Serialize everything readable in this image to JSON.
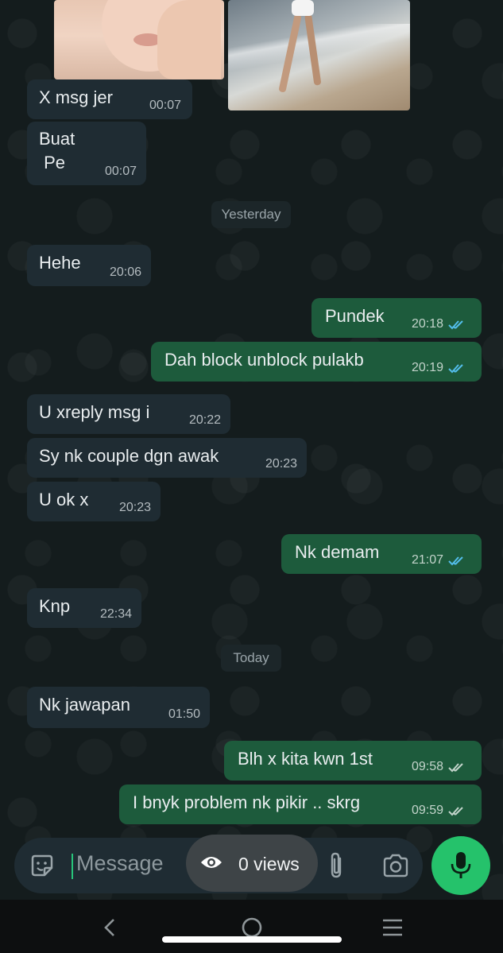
{
  "messages": [
    {
      "text": "X msg jer",
      "time": "00:07"
    },
    {
      "text": "Buat\n Pe",
      "time": "00:07"
    },
    {
      "text": "Hehe",
      "time": "20:06"
    },
    {
      "text": "Pundek",
      "time": "20:18"
    },
    {
      "text": "Dah block unblock pulakb",
      "time": "20:19"
    },
    {
      "text": "U xreply msg i",
      "time": "20:22"
    },
    {
      "text": "Sy nk couple dgn awak",
      "time": "20:23"
    },
    {
      "text": "U ok x",
      "time": "20:23"
    },
    {
      "text": "Nk demam",
      "time": "21:07"
    },
    {
      "text": "Knp",
      "time": "22:34"
    },
    {
      "text": "Nk jawapan",
      "time": "01:50"
    },
    {
      "text": "Blh x kita kwn 1st",
      "time": "09:58"
    },
    {
      "text": "I bnyk problem nk pikir .. skrg",
      "time": "09:59"
    }
  ],
  "dividers": {
    "yesterday": "Yesterday",
    "today": "Today"
  },
  "composer": {
    "placeholder": "Message",
    "views": "0 views"
  },
  "colors": {
    "incoming": "#1f2c33",
    "outgoing": "#1d5b3c",
    "accent": "#25c26b",
    "read_ticks": "#53bdeb"
  }
}
